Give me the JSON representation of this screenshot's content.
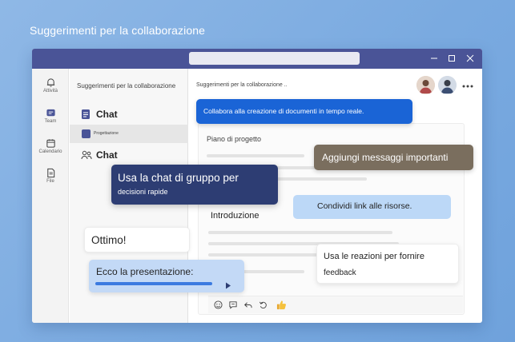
{
  "hero_title": "Suggerimenti per la collaborazione",
  "rail": {
    "items": [
      {
        "label": "Attività",
        "icon": "bell-icon"
      },
      {
        "label": "Team",
        "icon": "chat-icon"
      },
      {
        "label": "Calendario",
        "icon": "calendar-icon"
      },
      {
        "label": "File",
        "icon": "file-icon"
      }
    ]
  },
  "list": {
    "header": "Suggerimenti per la collaborazione",
    "chat_label": "Chat",
    "selected_item": "Progettazione",
    "chat_label_2": "Chat"
  },
  "main": {
    "header": "Suggerimenti per la collaborazione ..",
    "doc_title": "Piano di progetto",
    "doc_section": "Introduzione"
  },
  "callouts": {
    "collabora": "Collabora alla creazione di documenti in tempo reale.",
    "aggiungi": "Aggiungi messaggi importanti",
    "chat_gruppo_title": "Usa la chat di gruppo per",
    "chat_gruppo_sub": "decisioni rapide",
    "condividi": "Condividi link alle risorse.",
    "ottimo": "Ottimo!",
    "presentazione": "Ecco la presentazione:",
    "reazioni_title": "Usa le reazioni per fornire",
    "reazioni_sub": "feedback"
  },
  "colors": {
    "titlebar": "#4a5497",
    "accent_blue": "#1a64d6",
    "navy": "#2d3d73",
    "taupe": "#7a6e5e",
    "light_blue": "#bcd8f7",
    "background": "#7aaae0"
  }
}
